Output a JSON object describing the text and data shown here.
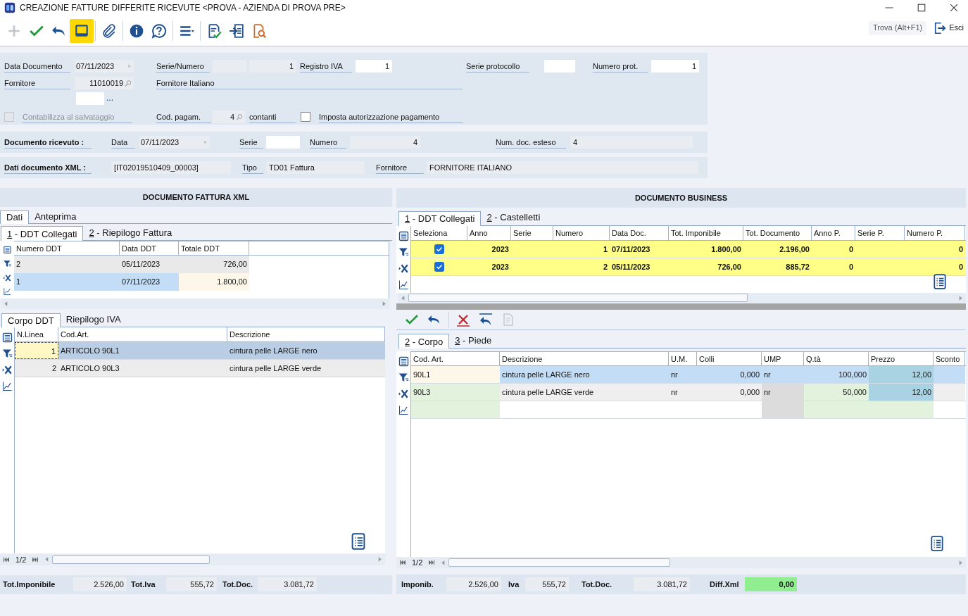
{
  "window": {
    "title": "CREAZIONE FATTURE DIFFERITE RICEVUTE <PROVA - AZIENDA DI PROVA PRE>"
  },
  "toolbar": [
    {
      "kind": "add",
      "disabled": true,
      "selected": false
    },
    {
      "kind": "confirm",
      "disabled": false,
      "selected": false
    },
    {
      "kind": "undo",
      "disabled": false,
      "selected": false
    },
    {
      "kind": "panel",
      "disabled": false,
      "selected": true
    },
    {
      "kind": "attach",
      "disabled": false,
      "selected": false
    },
    {
      "kind": "info",
      "disabled": false,
      "selected": false
    },
    {
      "kind": "help",
      "disabled": false,
      "selected": false
    },
    {
      "kind": "menu",
      "disabled": false,
      "selected": false
    },
    {
      "kind": "checklist",
      "disabled": false,
      "selected": false
    },
    {
      "kind": "import",
      "disabled": false,
      "selected": false
    },
    {
      "kind": "docsearch",
      "disabled": false,
      "selected": false
    }
  ],
  "find_button": "Trova (Alt+F1)",
  "exit_button": "Esci",
  "form": {
    "data_documento": {
      "label": "Data Documento",
      "value": "07/11/2023"
    },
    "serie_numero": {
      "label": "Serie/Numero",
      "numero": "1"
    },
    "registro_iva": {
      "label": "Registro IVA",
      "value": "1"
    },
    "serie_protocollo": {
      "label": "Serie protocollo"
    },
    "numero_prot": {
      "label": "Numero prot.",
      "value": "1"
    },
    "fornitore": {
      "label": "Fornitore",
      "code": "11010019",
      "name": "Fornitore Italiano"
    },
    "more_button": "...",
    "contabilizza": {
      "label": "Contabilizza al salvataggio",
      "checked": false,
      "disabled": true
    },
    "cod_pagam": {
      "label": "Cod. pagam.",
      "value": "4",
      "description": "contanti"
    },
    "autorizzazione": {
      "label": "Imposta autorizzazione pagamento",
      "checked": false
    }
  },
  "documento_ricevuto": {
    "title": "Documento ricevuto :",
    "data_label": "Data",
    "data": "07/11/2023",
    "serie_label": "Serie",
    "numero_label": "Numero",
    "numero": "4",
    "esteso_label": "Num. doc. esteso",
    "esteso": "4"
  },
  "dati_xml": {
    "title": "Dati documento XML :",
    "id": "[IT02019510409_00003]",
    "tipo_label": "Tipo",
    "tipo": "TD01 Fattura",
    "fornitore_label": "Fornitore",
    "fornitore": "FORNITORE ITALIANO"
  },
  "left": {
    "title": "DOCUMENTO FATTURA XML",
    "tabs": [
      {
        "label": "Dati",
        "selected": true
      },
      {
        "label": "Anteprima",
        "selected": false
      }
    ],
    "subtabs": [
      {
        "key": "1",
        "label": " - DDT Collegati",
        "selected": true
      },
      {
        "key": "2",
        "label": " - Riepilogo Fattura",
        "selected": false
      }
    ],
    "ddt_table": {
      "columns": [
        "Numero DDT",
        "Data DDT",
        "Totale DDT"
      ],
      "rows": [
        {
          "cells": [
            "2",
            "05/11/2023",
            "726,00"
          ],
          "selected": false
        },
        {
          "cells": [
            "1",
            "07/11/2023",
            "1.800,00"
          ],
          "selected": true
        }
      ]
    },
    "body_tabs": [
      {
        "label": "Corpo DDT",
        "selected": true
      },
      {
        "label": "Riepilogo IVA",
        "selected": false
      }
    ],
    "body_table": {
      "columns": [
        "N.Linea",
        "Cod.Art.",
        "Descrizione"
      ],
      "rows": [
        {
          "cells": [
            "1",
            "ARTICOLO 90L1",
            "cintura pelle LARGE nero"
          ],
          "selected": true
        },
        {
          "cells": [
            "2",
            "ARTICOLO 90L3",
            "cintura pelle LARGE verde"
          ],
          "selected": false
        }
      ]
    },
    "pager": "1/2",
    "totals": [
      {
        "label": "Tot.Imponibile",
        "value": "2.526,00",
        "highlighted": false
      },
      {
        "label": "Tot.Iva",
        "value": "555,72",
        "highlighted": false
      },
      {
        "label": "Tot.Doc.",
        "value": "3.081,72",
        "highlighted": false
      }
    ]
  },
  "right": {
    "title": "DOCUMENTO BUSINESS",
    "tabs": [
      {
        "key": "1",
        "label": " - DDT Collegati",
        "selected": true
      },
      {
        "key": "2",
        "label": " - Castelletti",
        "selected": false
      }
    ],
    "ddt_table": {
      "columns": [
        "Seleziona",
        "Anno",
        "Serie",
        "Numero",
        "Data Doc.",
        "Tot. Imponibile",
        "Tot. Documento",
        "Anno P.",
        "Serie P.",
        "Numero P."
      ],
      "rows": [
        {
          "checked": true,
          "anno": "2023",
          "numero": "1",
          "data": "07/11/2023",
          "imponibile": "1.800,00",
          "documento": "2.196,00",
          "anno_p": "0",
          "numero_p": "0"
        },
        {
          "checked": true,
          "anno": "2023",
          "numero": "2",
          "data": "05/11/2023",
          "imponibile": "726,00",
          "documento": "885,72",
          "anno_p": "0",
          "numero_p": "0"
        }
      ]
    },
    "actions": [
      {
        "kind": "confirm",
        "disabled": false
      },
      {
        "kind": "undo",
        "disabled": false
      },
      {
        "kind": "delete",
        "disabled": false
      },
      {
        "kind": "revert",
        "disabled": false
      },
      {
        "kind": "xmldoc",
        "disabled": true
      }
    ],
    "body_tabs": [
      {
        "key": "2",
        "label": " - Corpo",
        "selected": true
      },
      {
        "key": "3",
        "label": " - Piede",
        "selected": false
      }
    ],
    "body_table": {
      "columns": [
        "Cod. Art.",
        "Descrizione",
        "U.M.",
        "Colli",
        "UMP",
        "Q.tà",
        "Prezzo",
        "Sconto"
      ],
      "rows": [
        {
          "cells": [
            "90L1",
            "cintura pelle LARGE nero",
            "nr",
            "0,000",
            "nr",
            "100,000",
            "12,00"
          ],
          "selected": true
        },
        {
          "cells": [
            "90L3",
            "cintura pelle LARGE verde",
            "nr",
            "0,000",
            "nr",
            "50,000",
            "12,00"
          ],
          "selected": false
        }
      ]
    },
    "pager": "1/2",
    "totals": [
      {
        "label": "Imponib.",
        "value": "2.526,00",
        "highlighted": false
      },
      {
        "label": "Iva",
        "value": "555,72",
        "highlighted": false
      },
      {
        "label": "Tot.Doc.",
        "value": "3.081,72",
        "highlighted": false
      },
      {
        "label": "Diff.Xml",
        "value": "0,00",
        "highlighted": true
      }
    ]
  }
}
